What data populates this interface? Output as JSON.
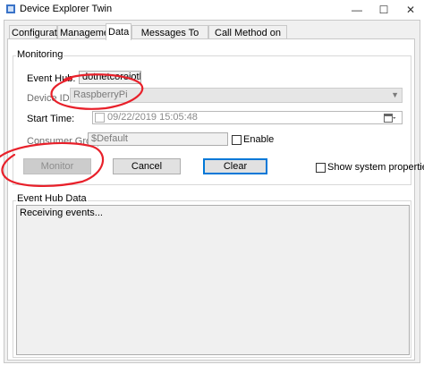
{
  "window": {
    "title": "Device Explorer Twin",
    "controls": {
      "minimize": "—",
      "maximize": "☐",
      "close": "✕"
    }
  },
  "tabs": [
    {
      "label": "Configuration",
      "active": false
    },
    {
      "label": "Management",
      "active": false
    },
    {
      "label": "Data",
      "active": true
    },
    {
      "label": "Messages To Device",
      "active": false
    },
    {
      "label": "Call Method on Device",
      "active": false
    }
  ],
  "monitoring": {
    "group_title": "Monitoring",
    "event_hub": {
      "label": "Event Hub:",
      "value": "dotnetcoreiothub"
    },
    "device_id": {
      "label": "Device ID:",
      "value": "RaspberryPi"
    },
    "start_time": {
      "label": "Start Time:",
      "value": "09/22/2019 15:05:48"
    },
    "consumer_group": {
      "label": "Consumer Group:",
      "value": "$Default",
      "enable_label": "Enable"
    },
    "buttons": {
      "monitor": "Monitor",
      "cancel": "Cancel",
      "clear": "Clear"
    },
    "show_system_properties": "Show system properties"
  },
  "event_hub_data": {
    "group_title": "Event Hub Data",
    "text": "Receiving events..."
  },
  "annotation_color": "#e8202a",
  "accent_color": "#0078d7"
}
